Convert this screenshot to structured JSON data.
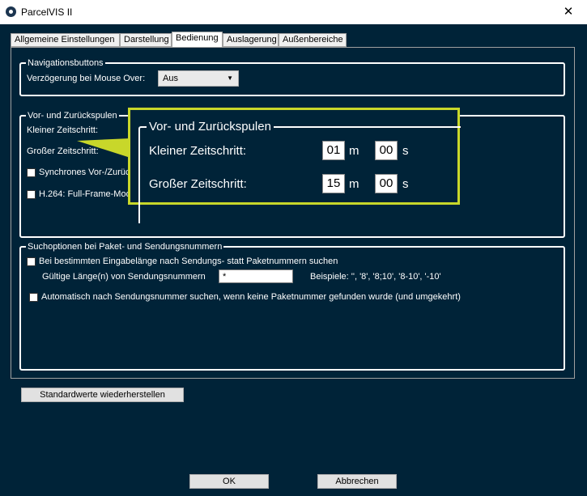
{
  "window": {
    "title": "ParcelVIS II",
    "close_glyph": "✕"
  },
  "tabs": [
    {
      "label": "Allgemeine Einstellungen",
      "active": false
    },
    {
      "label": "Darstellung",
      "active": false
    },
    {
      "label": "Bedienung",
      "active": true
    },
    {
      "label": "Auslagerung",
      "active": false
    },
    {
      "label": "Außenbereiche",
      "active": false
    }
  ],
  "navigation": {
    "group_title": "Navigationsbuttons",
    "delay_label": "Verzögerung bei Mouse Over:",
    "delay_value": "Aus"
  },
  "rewind": {
    "group_title": "Vor- und Zurückspulen",
    "small_step_label": "Kleiner Zeitschritt:",
    "large_step_label": "Großer Zeitschritt:",
    "sync_label": "Synchrones Vor-/Zurüc",
    "h264_label": "H.264: Full-Frame-Mod"
  },
  "zoom": {
    "title": "Vor- und Zurückspulen",
    "small_label": "Kleiner Zeitschritt:",
    "small_min": "01",
    "small_sec": "00",
    "large_label": "Großer Zeitschritt:",
    "large_min": "15",
    "large_sec": "00",
    "unit_m": "m",
    "unit_s": "s"
  },
  "search": {
    "group_title": "Suchoptionen bei Paket- und Sendungsnummern",
    "length_option_label": "Bei bestimmten Eingabelänge nach Sendungs- statt Paketnummern suchen",
    "valid_length_label": "Gültige Länge(n) von Sendungsnummern",
    "valid_length_value": "*",
    "examples_label": "Beispiele: '', '8', '8;10', '8-10', '-10'",
    "auto_option_label": "Automatisch nach Sendungsnummer suchen, wenn keine Paketnummer gefunden wurde (und umgekehrt)"
  },
  "buttons": {
    "restore": "Standardwerte wiederherstellen",
    "ok": "OK",
    "cancel": "Abbrechen"
  },
  "colors": {
    "background": "#002338",
    "highlight": "#c8d72a"
  }
}
